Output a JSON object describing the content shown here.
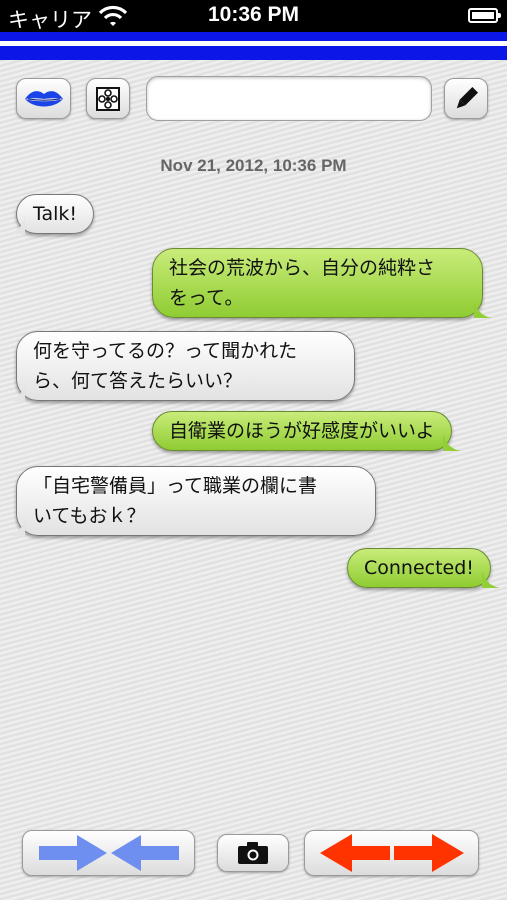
{
  "status_bar": {
    "carrier": "キャリア",
    "time": "10:36 PM",
    "icons": [
      "wifi-icon",
      "battery-icon"
    ]
  },
  "header": {
    "stripe_colors": [
      "#0a17e6",
      "#ffffff",
      "#0a17e6"
    ]
  },
  "toolbar": {
    "buttons": [
      "lips-icon",
      "flower-settings-icon",
      "pencil-icon"
    ],
    "input_value": "",
    "input_placeholder": ""
  },
  "conversation": {
    "timestamp": "Nov 21, 2012, 10:36 PM",
    "messages": [
      {
        "side": "incoming",
        "text": "Talk!"
      },
      {
        "side": "outgoing",
        "lines": [
          "社会の荒波から、自分の純粋さ",
          "をって。"
        ]
      },
      {
        "side": "incoming",
        "lines": [
          "何を守ってるの？って聞かれた",
          "ら、何て答えたらいい？"
        ]
      },
      {
        "side": "outgoing",
        "text": "自衛業のほうが好感度がいいよ"
      },
      {
        "side": "incoming",
        "lines": [
          "「自宅警備員」って職業の欄に書",
          "いてもおｋ？"
        ]
      },
      {
        "side": "outgoing",
        "text": "Connected!"
      }
    ]
  },
  "bottom_bar": {
    "buttons": [
      "converging-arrows-icon",
      "camera-icon",
      "diverging-arrows-icon"
    ],
    "colors": {
      "blue_arrows": "#6f8ff0",
      "red_arrows": "#ff3300"
    }
  },
  "colors": {
    "incoming_bubble": "#f0f0f0",
    "outgoing_bubble": "#a8dc4c",
    "lips": "#1a44e8"
  }
}
